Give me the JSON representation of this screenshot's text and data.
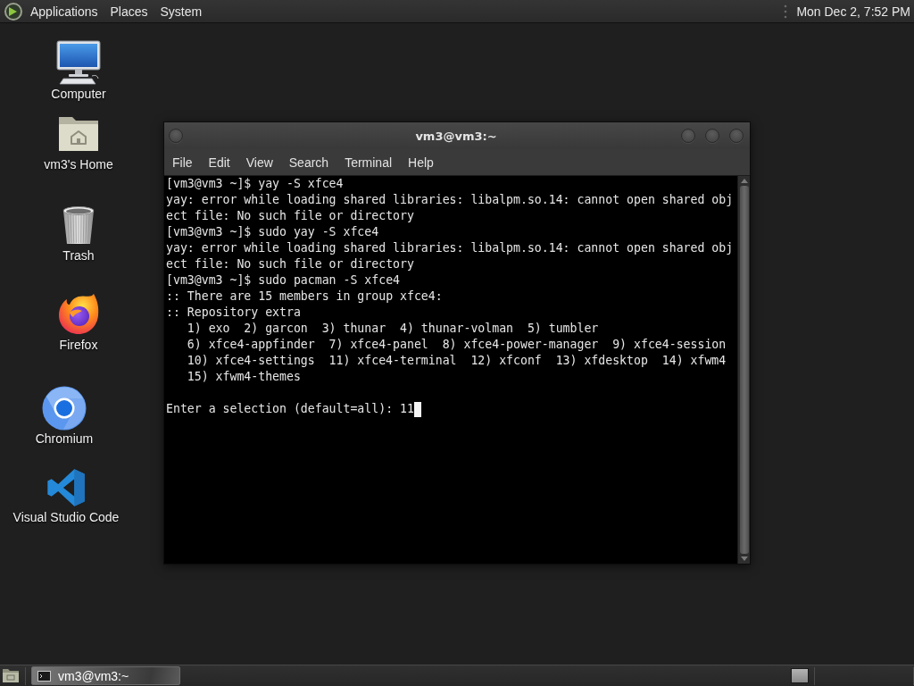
{
  "top_panel": {
    "menus": [
      "Applications",
      "Places",
      "System"
    ],
    "clock": "Mon Dec 2, 7:52 PM"
  },
  "desktop_icons": [
    {
      "kind": "computer",
      "label": "Computer"
    },
    {
      "kind": "home",
      "label": "vm3's Home"
    },
    {
      "kind": "trash",
      "label": "Trash"
    },
    {
      "kind": "firefox",
      "label": "Firefox"
    },
    {
      "kind": "chromium",
      "label": "Chromium"
    },
    {
      "kind": "vscode",
      "label": "Visual Studio Code"
    }
  ],
  "terminal_window": {
    "title": "vm3@vm3:~",
    "menu": [
      "File",
      "Edit",
      "View",
      "Search",
      "Terminal",
      "Help"
    ],
    "lines": [
      "[vm3@vm3 ~]$ yay -S xfce4",
      "yay: error while loading shared libraries: libalpm.so.14: cannot open shared obj",
      "ect file: No such file or directory",
      "[vm3@vm3 ~]$ sudo yay -S xfce4",
      "yay: error while loading shared libraries: libalpm.so.14: cannot open shared obj",
      "ect file: No such file or directory",
      "[vm3@vm3 ~]$ sudo pacman -S xfce4",
      ":: There are 15 members in group xfce4:",
      ":: Repository extra",
      "   1) exo  2) garcon  3) thunar  4) thunar-volman  5) tumbler",
      "   6) xfce4-appfinder  7) xfce4-panel  8) xfce4-power-manager  9) xfce4-session",
      "   10) xfce4-settings  11) xfce4-terminal  12) xfconf  13) xfdesktop  14) xfwm4",
      "   15) xfwm4-themes"
    ],
    "input": {
      "prompt": "Enter a selection (default=all):",
      "value": "11"
    }
  },
  "taskbar": {
    "tasks": [
      {
        "label": "vm3@vm3:~",
        "selected": true
      }
    ]
  }
}
